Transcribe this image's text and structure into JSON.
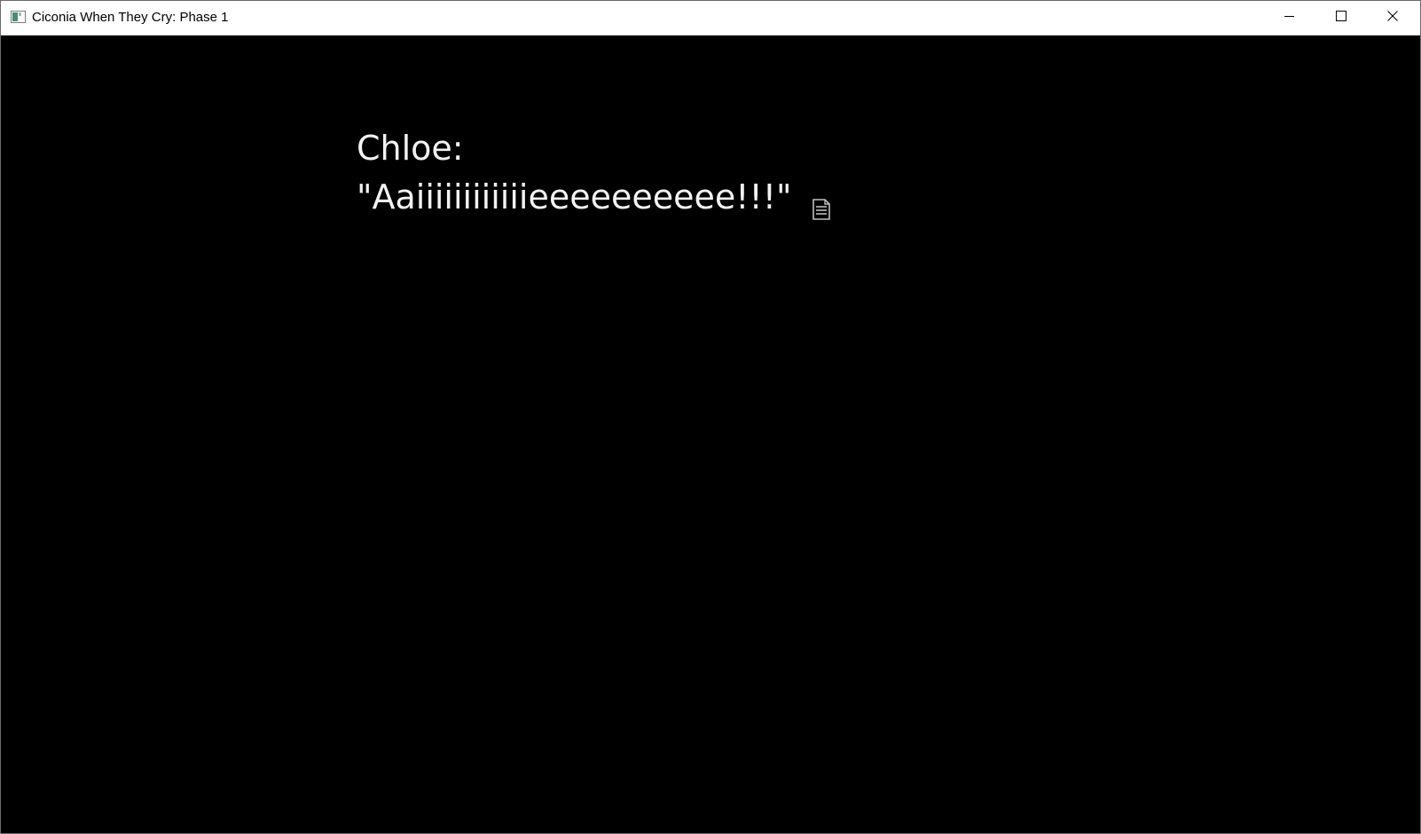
{
  "window": {
    "title": "Ciconia When They Cry: Phase 1",
    "app_icon": "app-window-icon",
    "controls": {
      "minimize_icon": "minimize-icon",
      "maximize_icon": "maximize-icon",
      "close_icon": "close-icon"
    }
  },
  "game": {
    "background_color": "#000000",
    "text_color": "#f2f2f2",
    "dialogue": {
      "speaker": "Chloe:",
      "line": "\"Aaiiiiiiiiiiiieeeeeeeeee!!!\"",
      "continue_icon": "page-wait-icon"
    }
  }
}
